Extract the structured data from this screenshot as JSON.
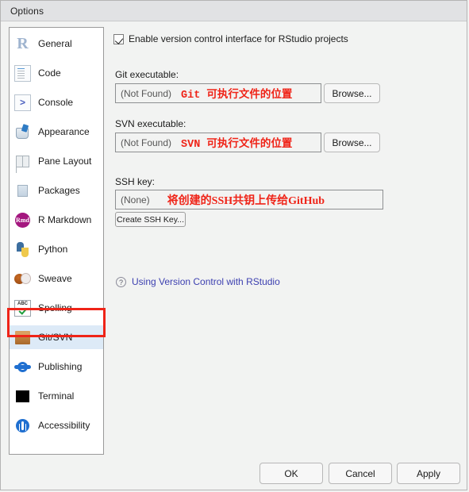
{
  "window": {
    "title": "Options"
  },
  "sidebar": {
    "items": [
      {
        "label": "General",
        "icon": "r-logo-icon",
        "selected": false
      },
      {
        "label": "Code",
        "icon": "document-code-icon",
        "selected": false
      },
      {
        "label": "Console",
        "icon": "prompt-arrow-icon",
        "selected": false
      },
      {
        "label": "Appearance",
        "icon": "paint-bucket-icon",
        "selected": false
      },
      {
        "label": "Pane Layout",
        "icon": "pane-grid-icon",
        "selected": false
      },
      {
        "label": "Packages",
        "icon": "package-box-icon",
        "selected": false
      },
      {
        "label": "R Markdown",
        "icon": "rmd-circle-icon",
        "selected": false,
        "icon_text": "Rmd"
      },
      {
        "label": "Python",
        "icon": "python-logo-icon",
        "selected": false
      },
      {
        "label": "Sweave",
        "icon": "sweave-icon",
        "selected": false
      },
      {
        "label": "Spelling",
        "icon": "spellcheck-abc-icon",
        "selected": false
      },
      {
        "label": "Git/SVN",
        "icon": "git-box-icon",
        "selected": true
      },
      {
        "label": "Publishing",
        "icon": "publishing-icon",
        "selected": false
      },
      {
        "label": "Terminal",
        "icon": "terminal-black-icon",
        "selected": false
      },
      {
        "label": "Accessibility",
        "icon": "accessibility-icon",
        "selected": false
      }
    ],
    "annotation_color": "#ef2418"
  },
  "main": {
    "enable_vcs": {
      "label": "Enable version control interface for RStudio projects",
      "checked": true
    },
    "git": {
      "label": "Git executable:",
      "value": "(Not Found)",
      "annotation": "Git 可执行文件的位置",
      "browse_label": "Browse..."
    },
    "svn": {
      "label": "SVN executable:",
      "value": "(Not Found)",
      "annotation": "SVN 可执行文件的位置",
      "browse_label": "Browse..."
    },
    "ssh": {
      "label": "SSH key:",
      "value": "(None)",
      "annotation": "将创建的SSH共钥上传给GitHub",
      "create_label": "Create SSH Key..."
    },
    "help_link": {
      "text": "Using Version Control with RStudio",
      "icon": "question-mark-icon",
      "color": "#3c3fb0"
    }
  },
  "footer": {
    "ok_label": "OK",
    "cancel_label": "Cancel",
    "apply_label": "Apply"
  }
}
